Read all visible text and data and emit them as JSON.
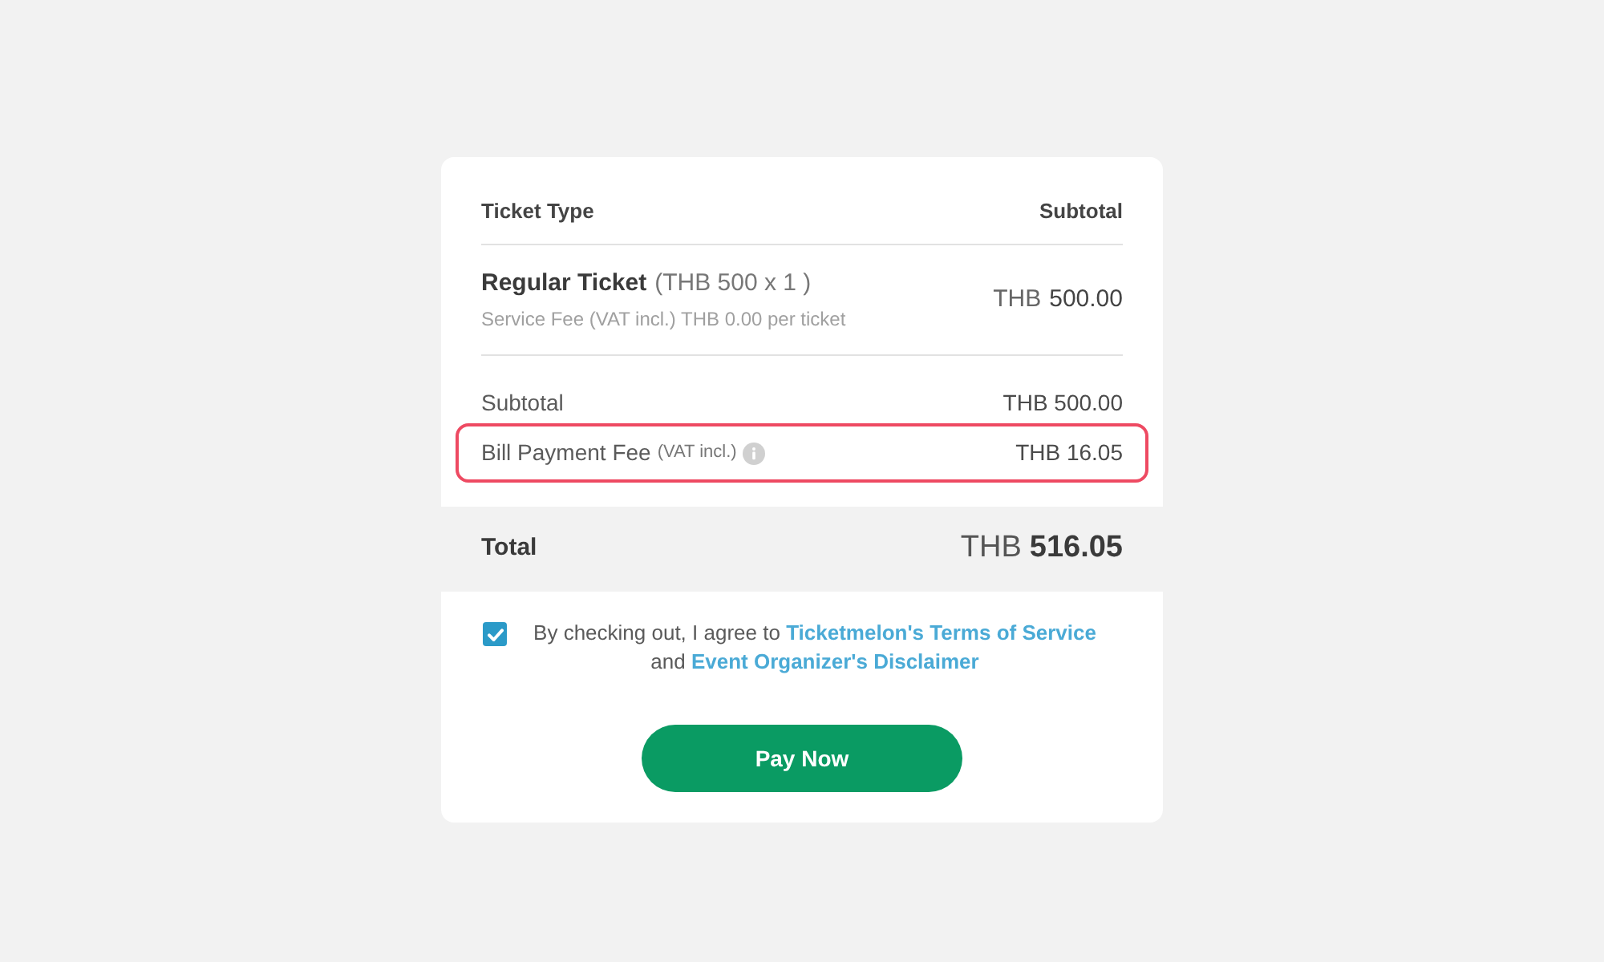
{
  "table": {
    "columns": [
      "Ticket Type",
      "Subtotal"
    ],
    "rows": [
      {
        "name": "Regular Ticket",
        "detail": "(THB 500 x 1 )",
        "fee_note": "Service Fee (VAT incl.) THB 0.00 per ticket",
        "currency": "THB",
        "amount": "500.00"
      }
    ]
  },
  "summary": [
    {
      "kind": "plain",
      "label": "Subtotal",
      "value": "THB 500.00",
      "highlighted": false
    },
    {
      "kind": "fee",
      "label": "Bill Payment Fee",
      "note": "(VAT incl.)",
      "value": "THB 16.05",
      "highlighted": true
    }
  ],
  "total": {
    "label": "Total",
    "currency": "THB",
    "amount": "516.05"
  },
  "agreement": {
    "checked": true,
    "parts": [
      {
        "kind": "text",
        "text": "By checking out, I agree to"
      },
      {
        "kind": "link",
        "text": "Ticketmelon's Terms of Service"
      },
      {
        "kind": "text",
        "text": "and"
      },
      {
        "kind": "link",
        "text": "Event Organizer's Disclaimer"
      }
    ]
  },
  "pay_button": "Pay Now"
}
